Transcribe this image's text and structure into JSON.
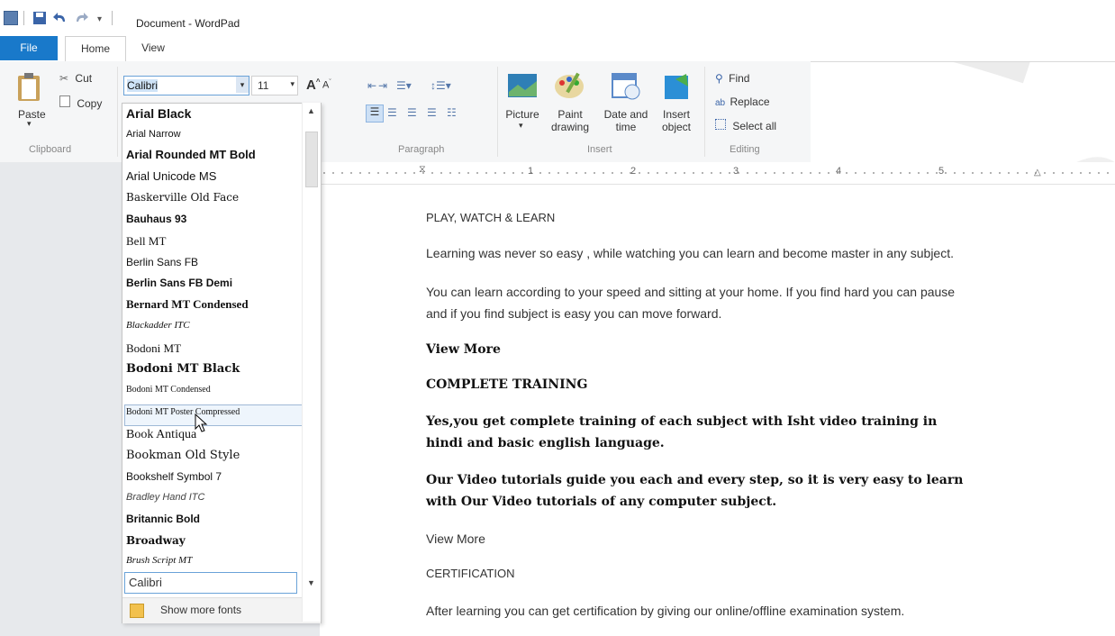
{
  "window": {
    "title": "Document - WordPad"
  },
  "tabs": {
    "file": "File",
    "home": "Home",
    "view": "View"
  },
  "clipboard": {
    "paste": "Paste",
    "cut": "Cut",
    "copy": "Copy",
    "label": "Clipboard"
  },
  "font": {
    "name": "Calibri",
    "size": "11"
  },
  "paragraph": {
    "label": "Paragraph"
  },
  "insert": {
    "picture": "Picture",
    "paint1": "Paint",
    "paint2": "drawing",
    "date1": "Date and",
    "date2": "time",
    "object1": "Insert",
    "object2": "object",
    "label": "Insert"
  },
  "editing": {
    "find": "Find",
    "replace": "Replace",
    "select_all": "Select all",
    "label": "Editing"
  },
  "ruler": {
    "marks": [
      "1",
      "2",
      "3",
      "4",
      "5"
    ]
  },
  "font_list": {
    "items": [
      "Arial Black",
      "Arial Narrow",
      "Arial Rounded MT Bold",
      "Arial Unicode MS",
      "Baskerville Old Face",
      "Bauhaus 93",
      "Bell MT",
      "Berlin Sans FB",
      "Berlin Sans FB Demi",
      "Bernard MT Condensed",
      "Blackadder ITC",
      "Bodoni MT",
      "Bodoni MT Black",
      "Bodoni MT Condensed",
      "Bodoni MT Poster Compressed",
      "Book Antiqua",
      "Bookman Old Style",
      "Bookshelf Symbol 7",
      "Bradley Hand ITC",
      "Britannic Bold",
      "Broadway",
      "Brush Script MT"
    ],
    "search_value": "Calibri",
    "show_more": "Show more fonts"
  },
  "document": {
    "p1": "PLAY, WATCH & LEARN",
    "p2": "Learning was never so easy , while watching you can learn and become master in any subject.",
    "p3a": "You can learn according to your speed and sitting at your home. If you find hard you can pause",
    "p3b": "and if you find subject is easy you can move forward.",
    "p4": "View More",
    "p5": "COMPLETE TRAINING",
    "p6a": "Yes,you get complete training of each subject with Isht video training in",
    "p6b": "hindi and basic english language.",
    "p7a": "Our Video tutorials guide you each and every step, so it is very easy to learn",
    "p7b": "with Our Video tutorials of any computer subject.",
    "p8": "View More",
    "p9": "CERTIFICATION",
    "p10": "After learning you can get certification by giving our online/offline examination system."
  },
  "colors": {
    "file_tab": "#1979ca",
    "ribbon_bg": "#f5f6f7"
  }
}
